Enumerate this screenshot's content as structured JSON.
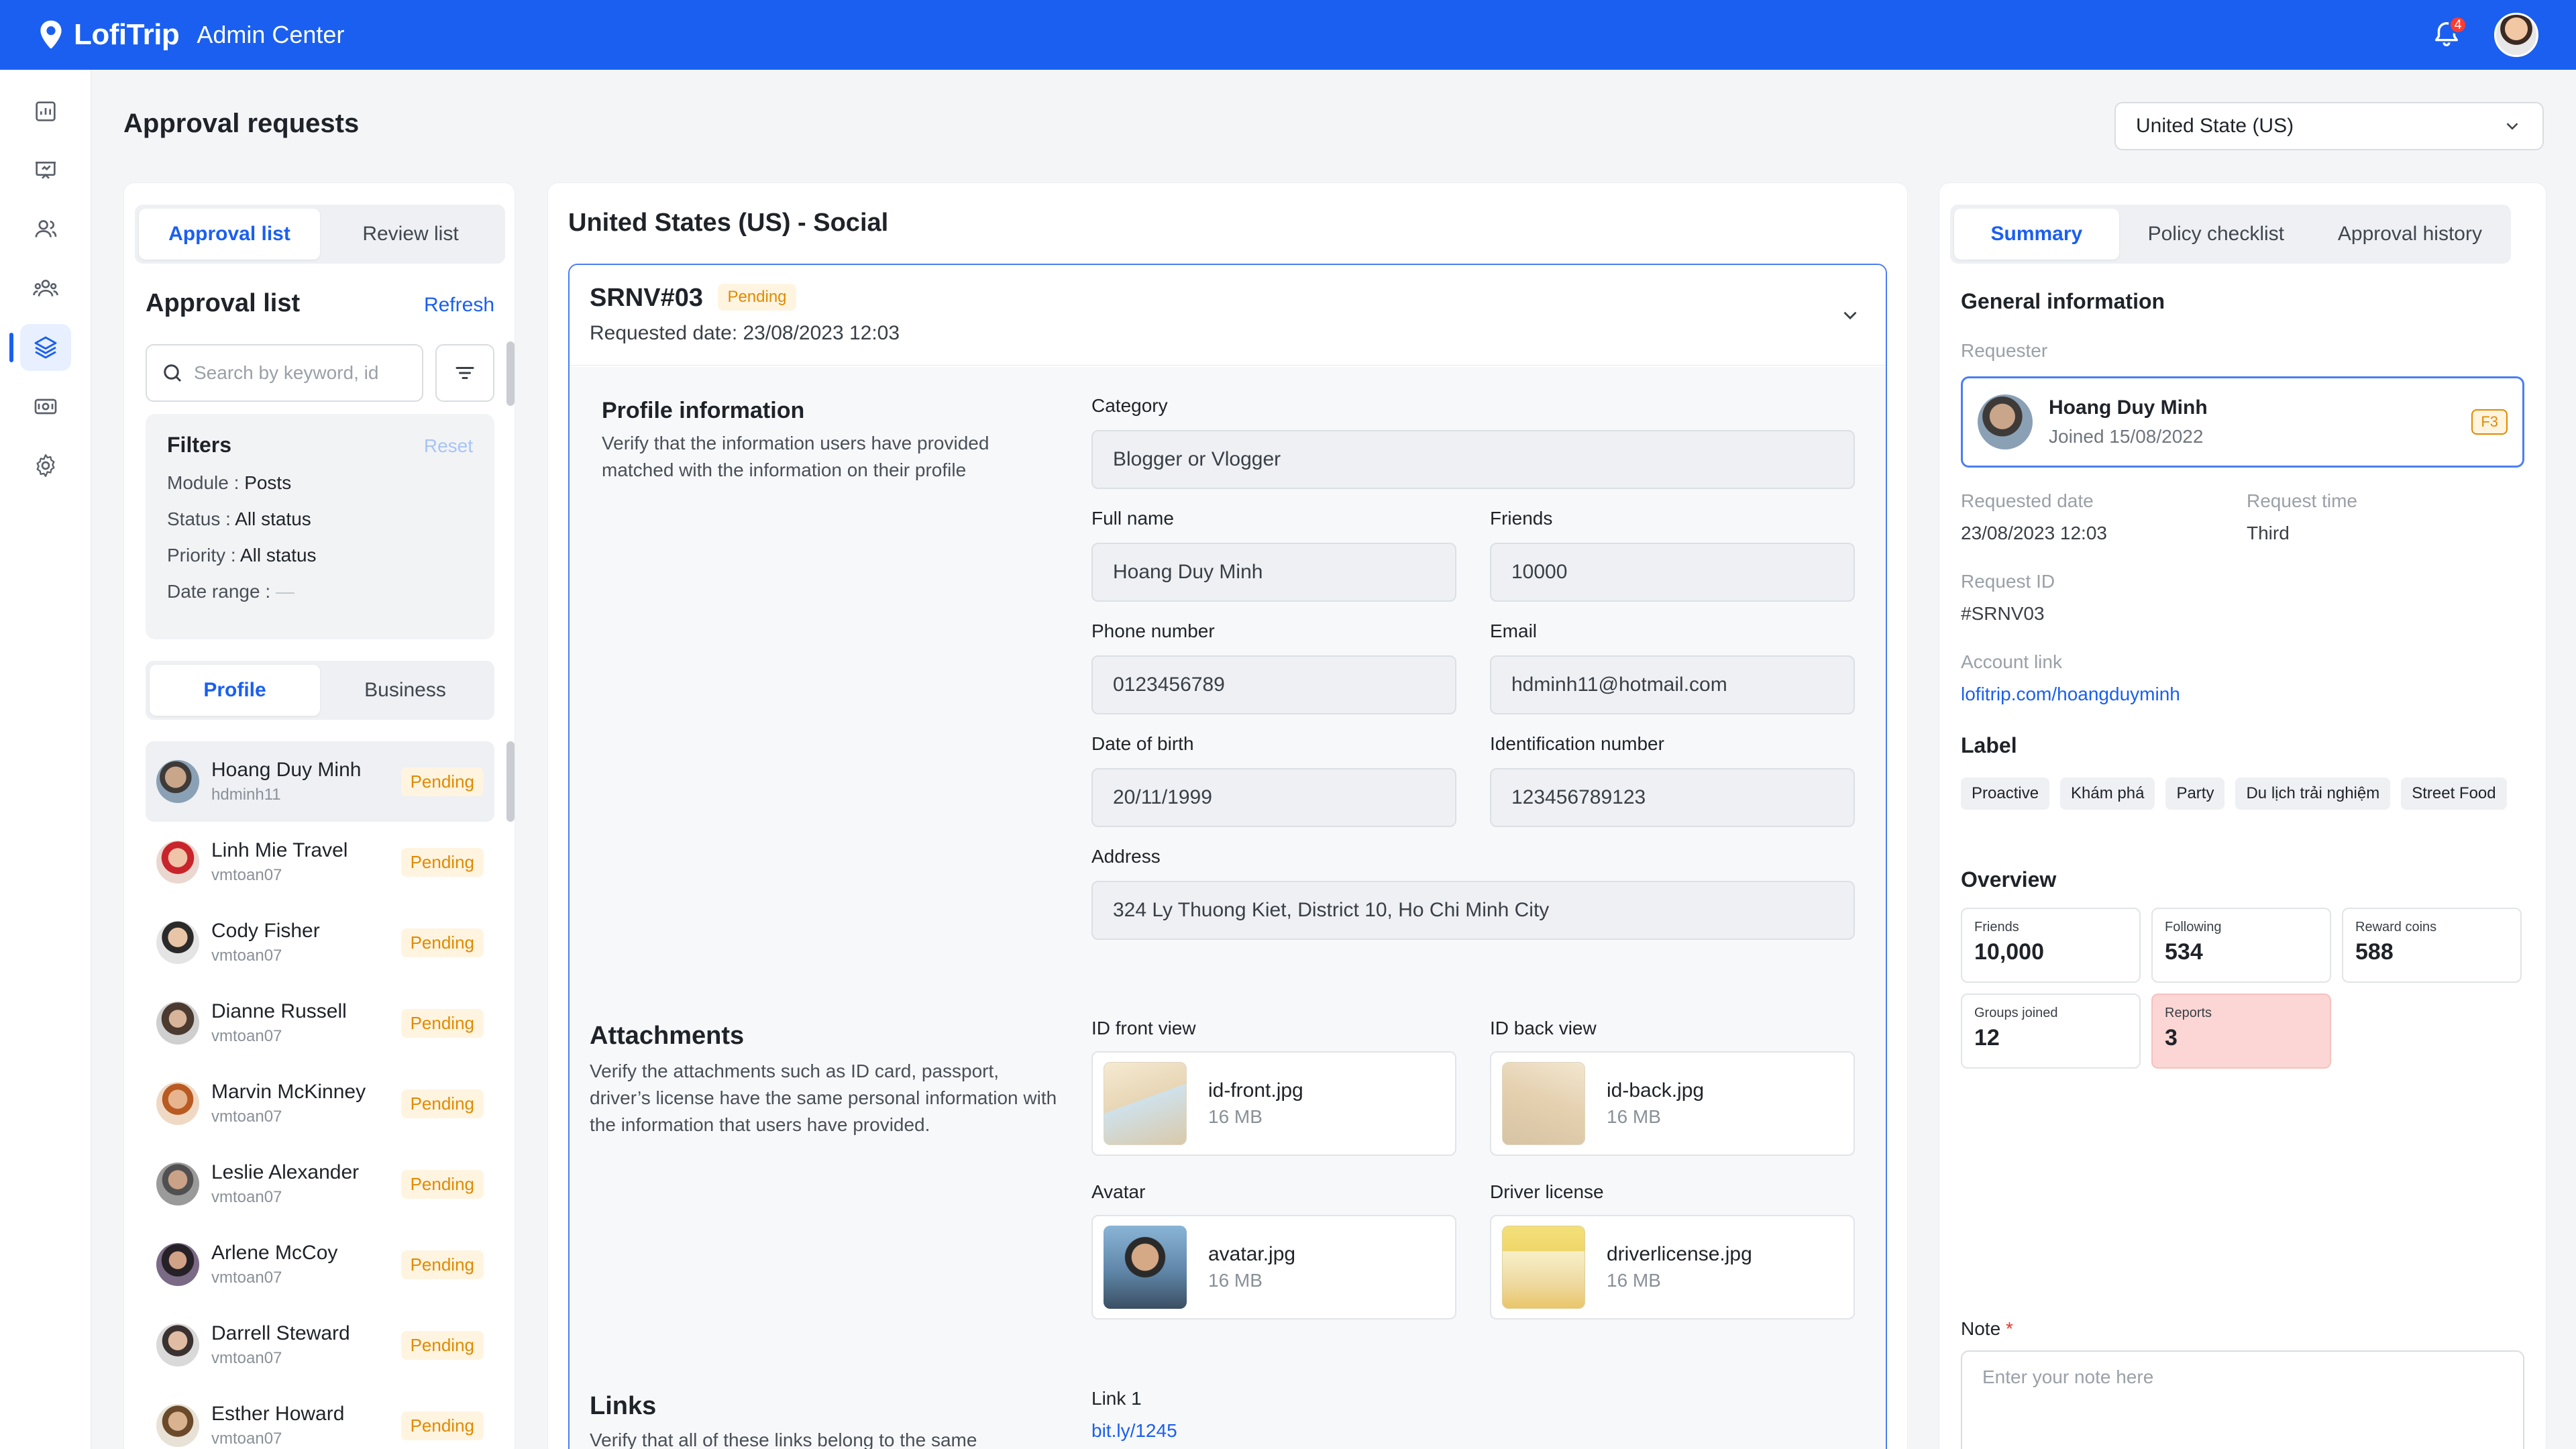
{
  "app": {
    "brand": "LofiTrip",
    "title": "Admin Center",
    "notifications_count": "4"
  },
  "page": {
    "title": "Approval requests",
    "country_select": "United State (US)"
  },
  "left_panel": {
    "tabs": [
      {
        "label": "Approval list",
        "active": true
      },
      {
        "label": "Review list",
        "active": false
      }
    ],
    "heading": "Approval list",
    "refresh_label": "Refresh",
    "search_placeholder": "Search by keyword, id",
    "filters": {
      "title": "Filters",
      "reset_label": "Reset",
      "rows": [
        {
          "key": "Module",
          "value": "Posts"
        },
        {
          "key": "Status",
          "value": "All status"
        },
        {
          "key": "Priority",
          "value": "All status"
        },
        {
          "key": "Date range",
          "value": "—"
        }
      ]
    },
    "type_tabs": [
      {
        "label": "Profile",
        "active": true
      },
      {
        "label": "Business",
        "active": false
      }
    ],
    "requests": [
      {
        "name": "Hoang Duy Minh",
        "username": "hdminh11",
        "status": "Pending"
      },
      {
        "name": "Linh Mie Travel",
        "username": "vmtoan07",
        "status": "Pending"
      },
      {
        "name": "Cody Fisher",
        "username": "vmtoan07",
        "status": "Pending"
      },
      {
        "name": "Dianne Russell",
        "username": "vmtoan07",
        "status": "Pending"
      },
      {
        "name": "Marvin McKinney",
        "username": "vmtoan07",
        "status": "Pending"
      },
      {
        "name": "Leslie Alexander",
        "username": "vmtoan07",
        "status": "Pending"
      },
      {
        "name": "Arlene McCoy",
        "username": "vmtoan07",
        "status": "Pending"
      },
      {
        "name": "Darrell Steward",
        "username": "vmtoan07",
        "status": "Pending"
      },
      {
        "name": "Esther Howard",
        "username": "vmtoan07",
        "status": "Pending"
      }
    ]
  },
  "middle_panel": {
    "title": "United States (US) - Social",
    "request": {
      "id": "SRNV#03",
      "status": "Pending",
      "requested_date": "Requested date: 23/08/2023 12:03"
    },
    "profile_section": {
      "title": "Profile information",
      "description": "Verify that the information users have provided matched with the information on their profile"
    },
    "fields": {
      "category": {
        "label": "Category",
        "value": "Blogger or Vlogger"
      },
      "full_name": {
        "label": "Full name",
        "value": "Hoang Duy Minh"
      },
      "friends": {
        "label": "Friends",
        "value": "10000"
      },
      "phone": {
        "label": "Phone number",
        "value": "0123456789"
      },
      "email": {
        "label": "Email",
        "value": "hdminh11@hotmail.com"
      },
      "dob": {
        "label": "Date of birth",
        "value": "20/11/1999"
      },
      "id_number": {
        "label": "Identification number",
        "value": "123456789123"
      },
      "address": {
        "label": "Address",
        "value": "324 Ly Thuong Kiet, District 10, Ho Chi Minh City"
      }
    },
    "attachments_section": {
      "title": "Attachments",
      "description": "Verify the attachments such as ID card, passport, driver’s license have the same personal information with the information that users have provided."
    },
    "attachments": {
      "id_front": {
        "label": "ID front view",
        "file": "id-front.jpg",
        "size": "16 MB"
      },
      "id_back": {
        "label": "ID back view",
        "file": "id-back.jpg",
        "size": "16 MB"
      },
      "avatar": {
        "label": "Avatar",
        "file": "avatar.jpg",
        "size": "16 MB"
      },
      "driver": {
        "label": "Driver license",
        "file": "driverlicense.jpg",
        "size": "16 MB"
      }
    },
    "links_section": {
      "title": "Links",
      "description": "Verify that all of these links belong to the same"
    },
    "links": [
      {
        "label": "Link 1",
        "value": "bit.ly/1245"
      }
    ]
  },
  "right_panel": {
    "tabs": [
      {
        "label": "Summary",
        "active": true
      },
      {
        "label": "Policy checklist",
        "active": false
      },
      {
        "label": "Approval history",
        "active": false
      }
    ],
    "general_title": "General information",
    "requester_label": "Requester",
    "requester": {
      "name": "Hoang Duy Minh",
      "joined": "Joined 15/08/2022",
      "tier": "F3"
    },
    "requested_date_label": "Requested date",
    "requested_date": "23/08/2023 12:03",
    "request_time_label": "Request time",
    "request_time": "Third",
    "request_id_label": "Request ID",
    "request_id": "#SRNV03",
    "account_link_label": "Account link",
    "account_link": "lofitrip.com/hoangduyminh",
    "label_title": "Label",
    "labels": [
      "Proactive",
      "Khám phá",
      "Party",
      "Du lịch trải nghiệm",
      "Street Food"
    ],
    "overview_title": "Overview",
    "overview": [
      {
        "label": "Friends",
        "value": "10,000"
      },
      {
        "label": "Following",
        "value": "534"
      },
      {
        "label": "Reward coins",
        "value": "588"
      },
      {
        "label": "Groups joined",
        "value": "12"
      },
      {
        "label": "Reports",
        "value": "3"
      }
    ],
    "note_label": "Note",
    "note_required": "*",
    "note_placeholder": "Enter your note here"
  },
  "colors": {
    "primary": "#1a5ff0",
    "pending_text": "#e08a00",
    "pending_bg": "#fff4e0",
    "reports_bg": "#fbd6d4"
  }
}
